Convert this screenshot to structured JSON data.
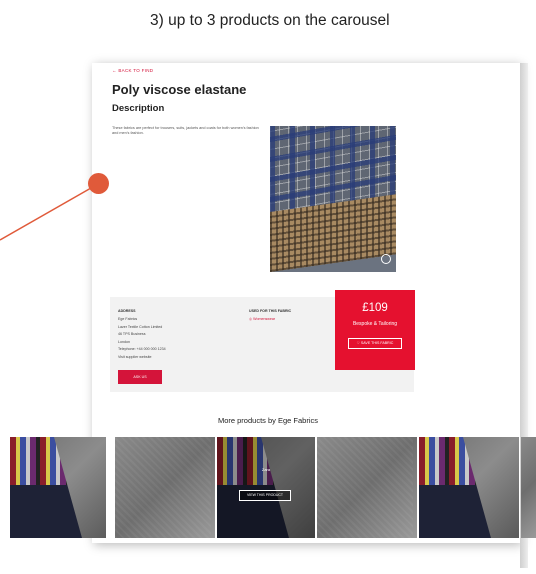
{
  "caption": "3) up to 3 products on the carousel",
  "product": {
    "back_link": "← BACK TO FIND",
    "title": "Poly viscose elastane",
    "description_heading": "Description",
    "description_text": "These fabrics are perfect for trousers, suits, jackets and coats for both women's fashion and men's fashion."
  },
  "supplier": {
    "address_heading": "ADDRESS",
    "address_lines": [
      "Ege Fabrics",
      "Lazer Textile Cotton Limited",
      "46 TPS Business",
      "London",
      "Telephone: +44 000 000 1234",
      "Visit supplier website"
    ],
    "ask_button": "ASK US",
    "used_heading": "USED FOR THIS FABRIC",
    "used_link": "Womenswear"
  },
  "price": {
    "amount": "£109",
    "category": "Bespoke & Tailoring",
    "save_button": "SAVE THIS FABRIC"
  },
  "carousel": {
    "heading": "More products by Ege Fabrics",
    "hover_name": "Zara",
    "hover_button": "VIEW THIS PRODUCT"
  },
  "colors": {
    "accent": "#e5112f",
    "annotation": "#e05a3a"
  }
}
